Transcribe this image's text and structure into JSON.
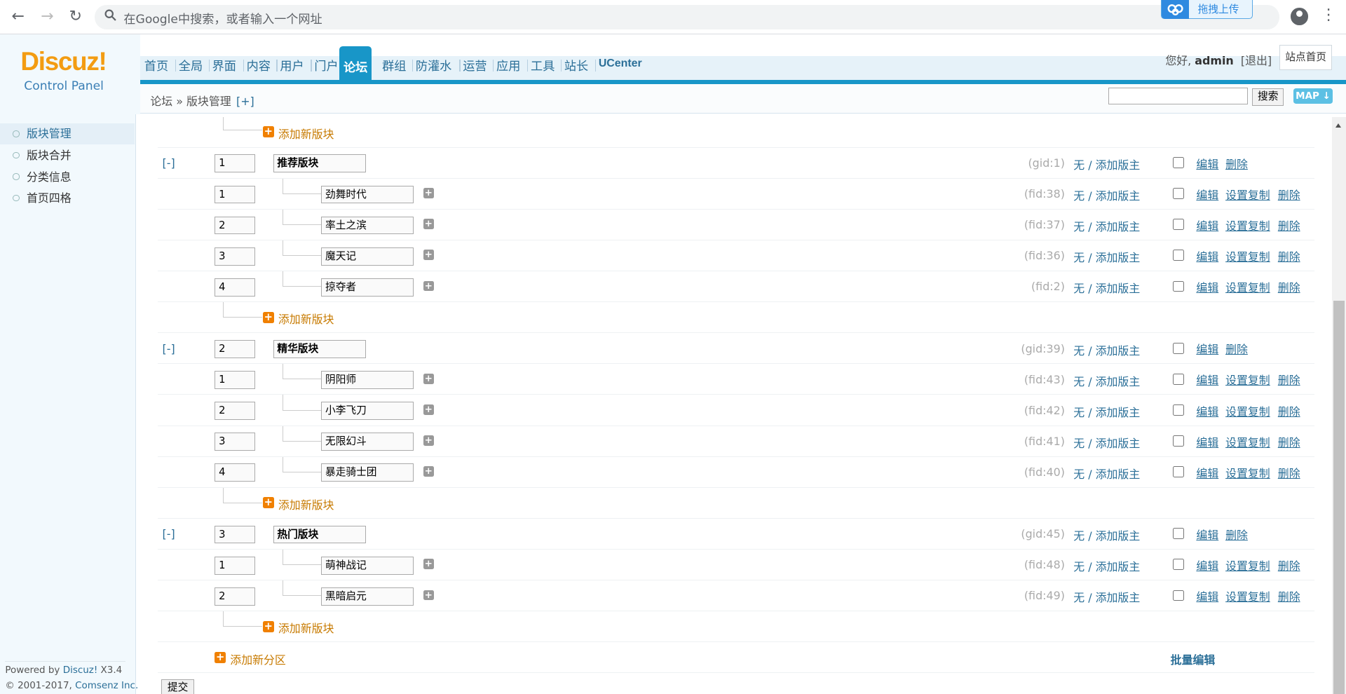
{
  "browser": {
    "omnibox_placeholder": "在Google中搜索，或者输入一个网址",
    "upload_label": "拖拽上传"
  },
  "logo": {
    "brand": "Discuz!",
    "subtitle": "Control Panel"
  },
  "nav": [
    "首页",
    "全局",
    "界面",
    "内容",
    "用户",
    "门户",
    "论坛",
    "群组",
    "防灌水",
    "运营",
    "应用",
    "工具",
    "站长",
    "UCenter"
  ],
  "nav_active": "论坛",
  "user": {
    "greeting": "您好,",
    "name": "admin",
    "logout": "[退出]",
    "site_home": "站点首页"
  },
  "breadcrumb": {
    "text": "论坛 » 版块管理",
    "plus": "[+]"
  },
  "search": {
    "button": "搜索",
    "map": "MAP ↓"
  },
  "sidebar": {
    "items": [
      "版块管理",
      "版块合并",
      "分类信息",
      "首页四格"
    ],
    "active": "版块管理",
    "powered_prefix": "Powered by ",
    "powered_link": "Discuz!",
    "version": " X3.4",
    "copyright_prefix": "© 2001-2017, ",
    "copyright_link": "Comsenz Inc."
  },
  "labels": {
    "collapse": "[-]",
    "add_forum": "添加新版块",
    "add_group": "添加新分区",
    "moderator": "无 / 添加版主",
    "edit": "编辑",
    "copy_settings": "设置复制",
    "delete": "删除",
    "batch_edit": "批量编辑",
    "submit": "提交"
  },
  "groups": [
    {
      "order": "1",
      "name": "推荐版块",
      "id": "(gid:1)",
      "forums": [
        {
          "order": "1",
          "name": "劲舞时代",
          "id": "(fid:38)"
        },
        {
          "order": "2",
          "name": "率土之滨",
          "id": "(fid:37)"
        },
        {
          "order": "3",
          "name": "魔天记",
          "id": "(fid:36)"
        },
        {
          "order": "4",
          "name": "掠夺者",
          "id": "(fid:2)"
        }
      ]
    },
    {
      "order": "2",
      "name": "精华版块",
      "id": "(gid:39)",
      "forums": [
        {
          "order": "1",
          "name": "阴阳师",
          "id": "(fid:43)"
        },
        {
          "order": "2",
          "name": "小李飞刀",
          "id": "(fid:42)"
        },
        {
          "order": "3",
          "name": "无限幻斗",
          "id": "(fid:41)"
        },
        {
          "order": "4",
          "name": "暴走骑士团",
          "id": "(fid:40)"
        }
      ]
    },
    {
      "order": "3",
      "name": "热门版块",
      "id": "(gid:45)",
      "forums": [
        {
          "order": "1",
          "name": "萌神战记",
          "id": "(fid:48)"
        },
        {
          "order": "2",
          "name": "黑暗启元",
          "id": "(fid:49)"
        }
      ]
    }
  ]
}
